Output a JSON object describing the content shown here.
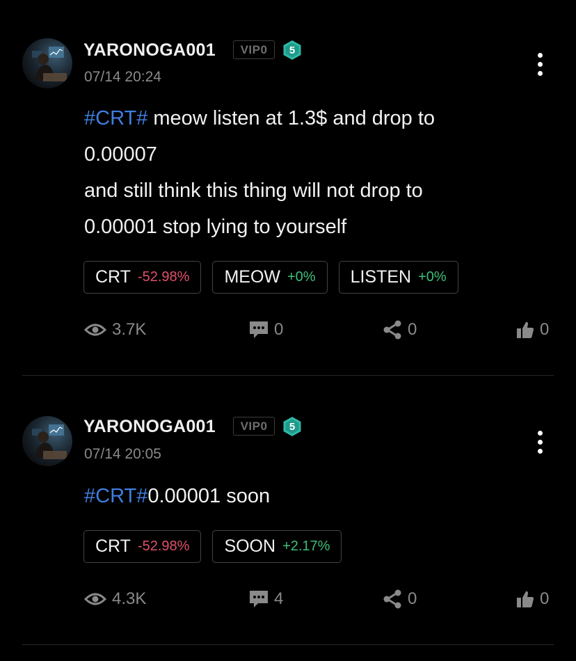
{
  "posts": [
    {
      "username": "YARONOGA001",
      "vip": "VIP0",
      "level": "5",
      "timestamp": "07/14 20:24",
      "body": {
        "hashtag": "#CRT#",
        "lines": [
          " meow listen at 1.3$ and drop to",
          "0.00007",
          "and still think this thing will not drop to",
          "0.00001 stop lying to yourself"
        ]
      },
      "tags": [
        {
          "name": "CRT",
          "change": "-52.98%",
          "direction": "down"
        },
        {
          "name": "MEOW",
          "change": "+0%",
          "direction": "up"
        },
        {
          "name": "LISTEN",
          "change": "+0%",
          "direction": "up"
        }
      ],
      "stats": {
        "views": "3.7K",
        "comments": "0",
        "shares": "0",
        "likes": "0"
      },
      "icons": [
        "avatar",
        "level-hexagon-icon",
        "more-vertical-icon",
        "eye-icon",
        "comment-icon",
        "share-icon",
        "thumbs-up-icon"
      ]
    },
    {
      "username": "YARONOGA001",
      "vip": "VIP0",
      "level": "5",
      "timestamp": "07/14 20:05",
      "body": {
        "hashtag": "#CRT#",
        "lines": [
          "0.00001 soon"
        ]
      },
      "tags": [
        {
          "name": "CRT",
          "change": "-52.98%",
          "direction": "down"
        },
        {
          "name": "SOON",
          "change": "+2.17%",
          "direction": "up"
        }
      ],
      "stats": {
        "views": "4.3K",
        "comments": "4",
        "shares": "0",
        "likes": "0"
      },
      "icons": [
        "avatar",
        "level-hexagon-icon",
        "more-vertical-icon",
        "eye-icon",
        "comment-icon",
        "share-icon",
        "thumbs-up-icon"
      ]
    }
  ],
  "colors": {
    "background": "#000000",
    "hashtag": "#3f7fe0",
    "negative": "#e0506a",
    "positive": "#3ebf7a",
    "level_badge": "#2fb8a6",
    "muted_text": "#8a8a8a"
  }
}
